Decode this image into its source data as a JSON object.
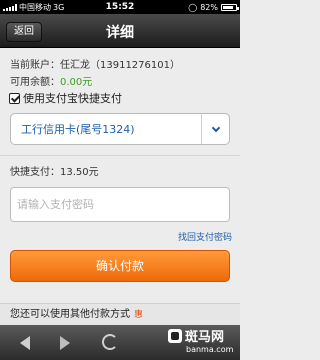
{
  "status_bar": {
    "carrier": "中国移动",
    "network": "3G",
    "time": "15:52",
    "battery_text": "82%",
    "battery_level": 0.82
  },
  "nav": {
    "back_label": "返回",
    "title": "详细"
  },
  "account": {
    "label": "当前账户：",
    "value": "任汇龙（13911276101）"
  },
  "balance": {
    "label": "可用余额：",
    "value": "0.00元"
  },
  "quick_pay_option": {
    "label": "使用支付宝快捷支付",
    "checked": true
  },
  "card_select": {
    "value": "工行信用卡(尾号1324)"
  },
  "quick_pay_amount": {
    "label": "快捷支付：",
    "value": "13.50元"
  },
  "password_input": {
    "placeholder": "请输入支付密码",
    "value": ""
  },
  "forgot_password_link": "找回支付密码",
  "confirm_button": "确认付款",
  "other_methods": {
    "text": "您还可以使用其他付款方式",
    "badge": "惠"
  },
  "watermark": {
    "name": "斑马网",
    "url": "banma.com"
  }
}
